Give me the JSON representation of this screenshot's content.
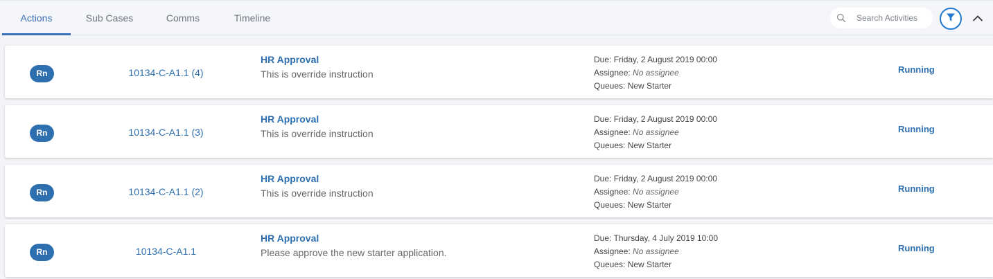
{
  "tabs": [
    {
      "label": "Actions",
      "active": true
    },
    {
      "label": "Sub Cases",
      "active": false
    },
    {
      "label": "Comms",
      "active": false
    },
    {
      "label": "Timeline",
      "active": false
    }
  ],
  "search": {
    "placeholder": "Search Activities",
    "icon": "search-icon"
  },
  "toolbar": {
    "filter_icon": "filter-icon",
    "collapse_icon": "chevron-up-icon"
  },
  "colors": {
    "accent": "#2e6fb0",
    "tab_active": "#3b6fb6",
    "filter_ring": "#1f7ad0",
    "background": "#f2f4f7"
  },
  "labels": {
    "due": "Due:",
    "assignee": "Assignee:",
    "queues": "Queues:"
  },
  "activities": [
    {
      "badge": "Rn",
      "case_id": "10134-C-A1.1 (4)",
      "title": "HR Approval",
      "instruction": "This is override instruction",
      "due": "Friday, 2 August 2019 00:00",
      "assignee": "No assignee",
      "queues": "New Starter",
      "status": "Running"
    },
    {
      "badge": "Rn",
      "case_id": "10134-C-A1.1 (3)",
      "title": "HR Approval",
      "instruction": "This is override instruction",
      "due": "Friday, 2 August 2019 00:00",
      "assignee": "No assignee",
      "queues": "New Starter",
      "status": "Running"
    },
    {
      "badge": "Rn",
      "case_id": "10134-C-A1.1 (2)",
      "title": "HR Approval",
      "instruction": "This is override instruction",
      "due": "Friday, 2 August 2019 00:00",
      "assignee": "No assignee",
      "queues": "New Starter",
      "status": "Running"
    },
    {
      "badge": "Rn",
      "case_id": "10134-C-A1.1",
      "title": "HR Approval",
      "instruction": "Please approve the new starter application.",
      "due": "Thursday, 4 July 2019 10:00",
      "assignee": "No assignee",
      "queues": "New Starter",
      "status": "Running"
    }
  ]
}
